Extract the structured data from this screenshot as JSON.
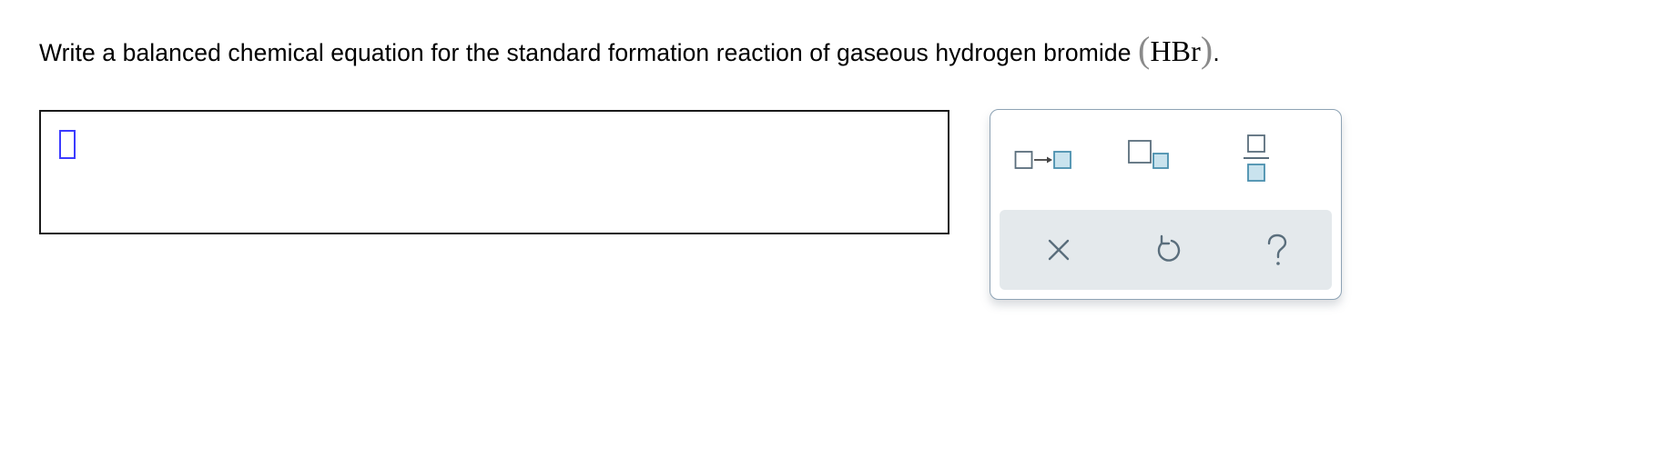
{
  "question": {
    "text": "Write a balanced chemical equation for the standard formation reaction of gaseous hydrogen bromide ",
    "formula_open": "(",
    "formula": "HBr",
    "formula_close": ")",
    "period": "."
  },
  "answer_box": {
    "value": ""
  },
  "palette": {
    "tools": [
      {
        "icon": "reaction-arrow-icon"
      },
      {
        "icon": "subscript-icon"
      },
      {
        "icon": "fraction-icon"
      }
    ],
    "actions": [
      {
        "icon": "clear-x-icon"
      },
      {
        "icon": "undo-icon"
      },
      {
        "icon": "help-question-icon"
      }
    ],
    "colors": {
      "accent_box": "#c9e3ee",
      "accent_border": "#4a8fae",
      "icon_gray": "#5a6e7c",
      "toolbar_bg": "#e4e9ec",
      "cursor": "#3b3bff"
    }
  }
}
